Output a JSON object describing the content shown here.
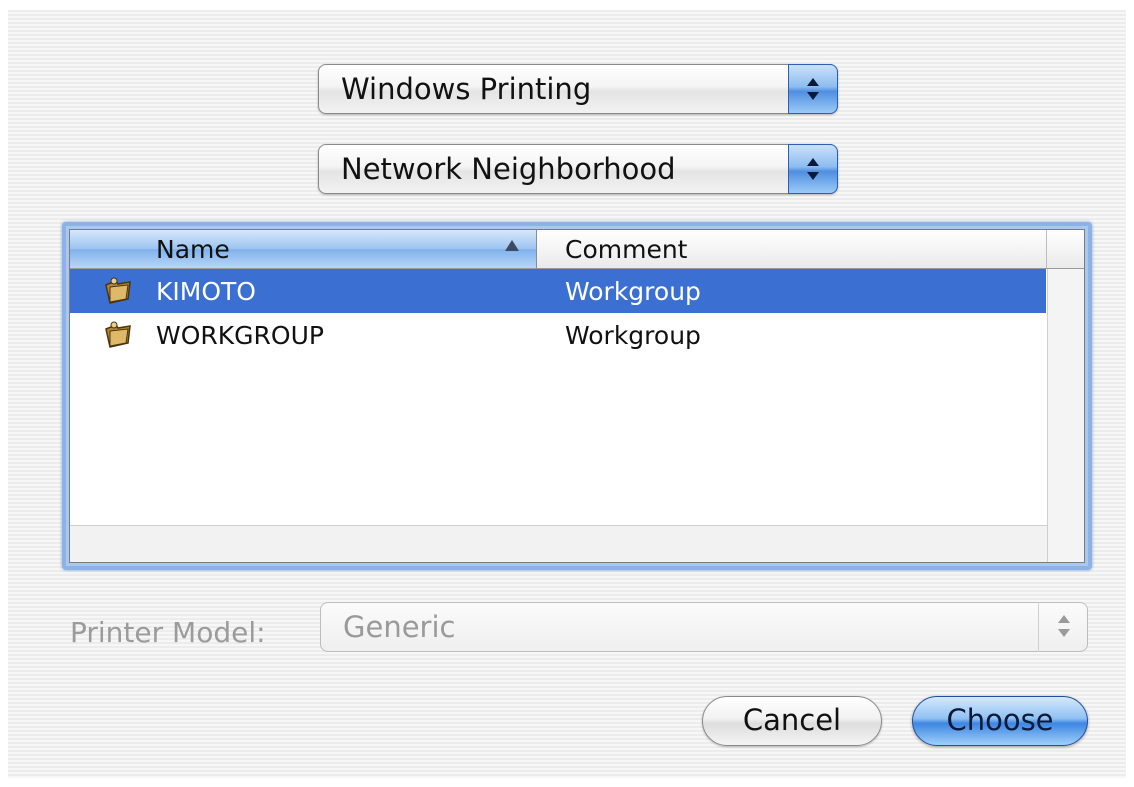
{
  "popups": {
    "protocol": "Windows Printing",
    "location": "Network Neighborhood"
  },
  "table": {
    "columns": [
      "Name",
      "Comment"
    ],
    "rows": [
      {
        "name": "KIMOTO",
        "comment": "Workgroup",
        "selected": true,
        "icon": "workgroup-folder-icon"
      },
      {
        "name": "WORKGROUP",
        "comment": "Workgroup",
        "selected": false,
        "icon": "workgroup-folder-icon"
      }
    ]
  },
  "printer_model": {
    "label": "Printer Model:",
    "value": "Generic",
    "disabled": true
  },
  "buttons": {
    "cancel": "Cancel",
    "choose": "Choose"
  },
  "colors": {
    "selection": "#3b6fd1",
    "accent": "#4f8fe0"
  }
}
